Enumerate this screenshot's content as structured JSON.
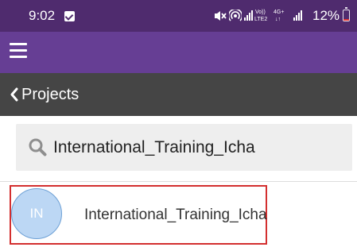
{
  "status_bar": {
    "time": "9:02",
    "network_label_top": "Vo))",
    "network_label_bottom": "LTE2",
    "data_label_top": "4G+",
    "data_label_bottom": "↓↑",
    "battery_percent": "12%",
    "battery_level": 0.12,
    "icons": [
      "message-icon",
      "mute-icon",
      "hotspot-icon",
      "signal-icon",
      "battery-icon"
    ]
  },
  "header": {
    "menu_icon": "hamburger-menu-icon"
  },
  "subheader": {
    "back_label": "Projects",
    "back_icon": "chevron-left-icon"
  },
  "search": {
    "value": "International_Training_Icha",
    "icon": "search-icon"
  },
  "projects": [
    {
      "initials": "IN",
      "name": "International_Training_Icha",
      "selected": true
    }
  ],
  "colors": {
    "status_bar": "#4f2b6e",
    "app_bar": "#663e94",
    "sub_bar": "#454545",
    "search_bg": "#eeeeee",
    "avatar_bg": "#bcd7f4",
    "selection_border": "#d32f2f"
  }
}
